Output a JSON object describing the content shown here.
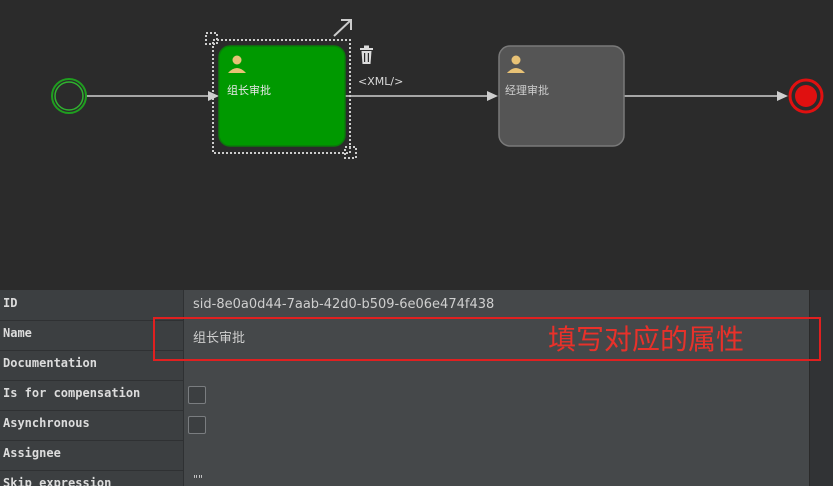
{
  "diagram": {
    "tasks": [
      {
        "label": "组长审批",
        "state": "selected",
        "fill": "#009900"
      },
      {
        "label": "经理审批",
        "state": "normal",
        "fill": "#555555"
      }
    ],
    "xml_label": "<XML/>",
    "start_color": "#1f9e1f",
    "end_color": "#e01010"
  },
  "properties": {
    "rows": [
      {
        "label": "ID",
        "value": "sid-8e0a0d44-7aab-42d0-b509-6e06e474f438"
      },
      {
        "label": "Name",
        "value": "组长审批"
      },
      {
        "label": "Documentation",
        "value": ""
      },
      {
        "label": "Is for compensation",
        "type": "checkbox"
      },
      {
        "label": "Asynchronous",
        "type": "checkbox"
      },
      {
        "label": "Assignee",
        "value": ""
      },
      {
        "label": "Skip expression",
        "value": "\"\""
      }
    ]
  },
  "annotation": {
    "text": "填写对应的属性",
    "color": "#e02020"
  }
}
